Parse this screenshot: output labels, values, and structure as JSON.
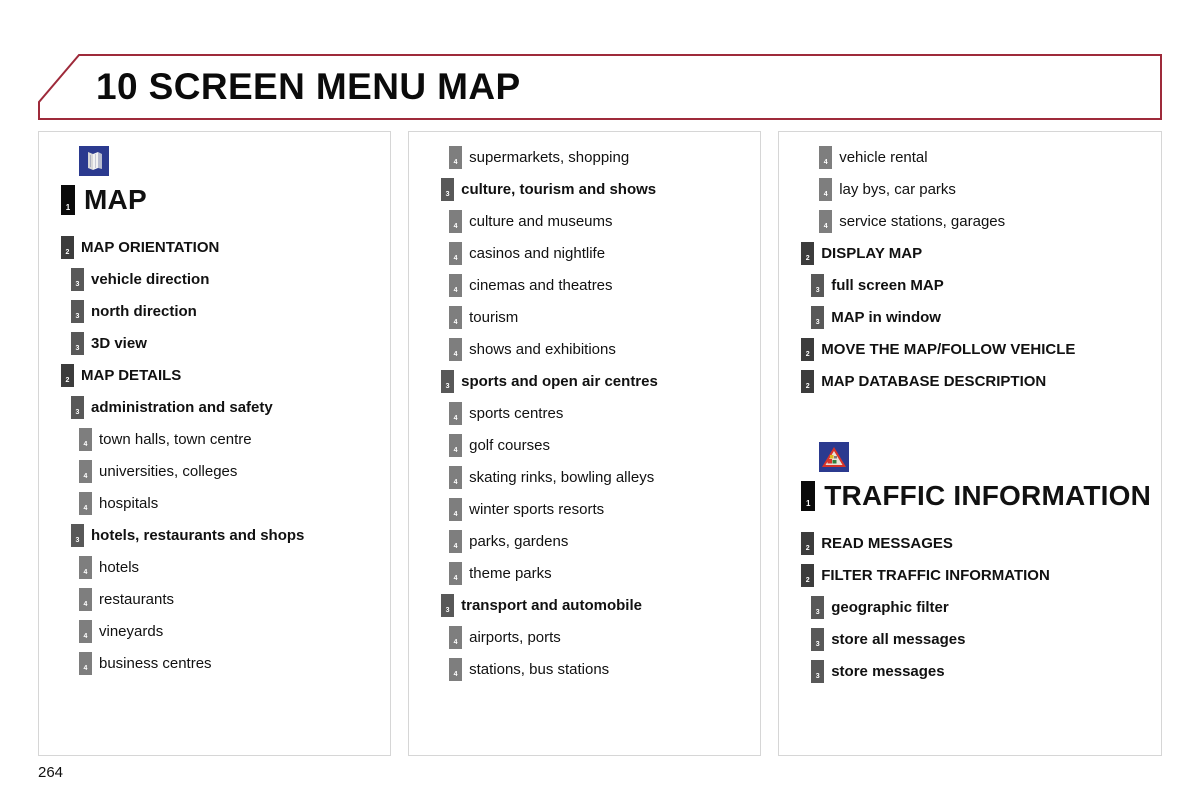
{
  "header": {
    "title": "10 SCREEN MENU MAP",
    "border_color": "#9e2a3a"
  },
  "page_number": "264",
  "badge_colors": {
    "level1": "#0a0a0a",
    "level2": "#3c3c3c",
    "level3": "#585858",
    "level4": "#7e7e7e"
  },
  "badge_labels": {
    "level1": "1",
    "level2": "2",
    "level3": "3",
    "level4": "4"
  },
  "icons": {
    "map": {
      "name": "map-icon",
      "background": "#2b3a8f",
      "sheet_color": "#d8d8d8"
    },
    "traffic": {
      "name": "traffic-warning-icon",
      "background": "#2b3a8f",
      "triangle_color": "#d7342a"
    }
  },
  "columns": [
    {
      "id": "column-1",
      "items": [
        {
          "level": 1,
          "text": "MAP",
          "icon": "map"
        },
        {
          "level": 2,
          "text": "MAP ORIENTATION"
        },
        {
          "level": 3,
          "text": "vehicle direction"
        },
        {
          "level": 3,
          "text": "north direction"
        },
        {
          "level": 3,
          "text": "3D view"
        },
        {
          "level": 2,
          "text": "MAP DETAILS"
        },
        {
          "level": 3,
          "text": "administration and safety"
        },
        {
          "level": 4,
          "text": "town halls, town centre"
        },
        {
          "level": 4,
          "text": "universities, colleges"
        },
        {
          "level": 4,
          "text": "hospitals"
        },
        {
          "level": 3,
          "text": "hotels, restaurants and shops"
        },
        {
          "level": 4,
          "text": "hotels"
        },
        {
          "level": 4,
          "text": "restaurants"
        },
        {
          "level": 4,
          "text": "vineyards"
        },
        {
          "level": 4,
          "text": "business centres"
        }
      ]
    },
    {
      "id": "column-2",
      "items": [
        {
          "level": 4,
          "text": "supermarkets, shopping"
        },
        {
          "level": 3,
          "text": "culture, tourism and shows"
        },
        {
          "level": 4,
          "text": "culture and museums"
        },
        {
          "level": 4,
          "text": "casinos and nightlife"
        },
        {
          "level": 4,
          "text": "cinemas and theatres"
        },
        {
          "level": 4,
          "text": "tourism"
        },
        {
          "level": 4,
          "text": "shows and exhibitions"
        },
        {
          "level": 3,
          "text": "sports and open air centres"
        },
        {
          "level": 4,
          "text": "sports centres"
        },
        {
          "level": 4,
          "text": "golf courses"
        },
        {
          "level": 4,
          "text": "skating rinks, bowling alleys"
        },
        {
          "level": 4,
          "text": "winter sports resorts"
        },
        {
          "level": 4,
          "text": "parks, gardens"
        },
        {
          "level": 4,
          "text": "theme parks"
        },
        {
          "level": 3,
          "text": "transport and automobile"
        },
        {
          "level": 4,
          "text": "airports, ports"
        },
        {
          "level": 4,
          "text": "stations, bus stations"
        }
      ]
    },
    {
      "id": "column-3",
      "items": [
        {
          "level": 4,
          "text": "vehicle rental"
        },
        {
          "level": 4,
          "text": "lay bys, car parks"
        },
        {
          "level": 4,
          "text": "service stations, garages"
        },
        {
          "level": 2,
          "text": "DISPLAY MAP"
        },
        {
          "level": 3,
          "text": "full screen MAP"
        },
        {
          "level": 3,
          "text": "MAP in window"
        },
        {
          "level": 2,
          "text": "MOVE THE MAP/FOLLOW VEHICLE"
        },
        {
          "level": 2,
          "text": "MAP DATABASE DESCRIPTION"
        },
        {
          "level": 1,
          "text": "TRAFFIC INFORMATION",
          "icon": "traffic",
          "spacer_before": 40
        },
        {
          "level": 2,
          "text": "READ MESSAGES"
        },
        {
          "level": 2,
          "text": "FILTER TRAFFIC INFORMATION"
        },
        {
          "level": 3,
          "text": "geographic filter"
        },
        {
          "level": 3,
          "text": "store all messages"
        },
        {
          "level": 3,
          "text": "store messages"
        }
      ]
    }
  ]
}
